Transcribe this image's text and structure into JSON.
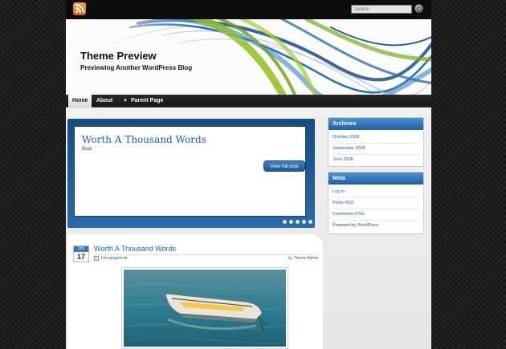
{
  "search": {
    "placeholder": "Search"
  },
  "header": {
    "site_title": "Theme Preview",
    "site_description": "Previewing Another WordPress Blog"
  },
  "nav": {
    "items": [
      {
        "label": "Home",
        "active": true
      },
      {
        "label": "About",
        "active": false
      },
      {
        "label": "Parent Page",
        "active": false,
        "has_dropdown": true
      }
    ]
  },
  "slider": {
    "title": "Worth A Thousand Words",
    "caption": "Boat",
    "button_label": "View full post",
    "dots": 5
  },
  "post": {
    "date_month": "Oct",
    "date_day": "17",
    "title": "Worth A Thousand Words",
    "category": "Uncategorized",
    "by_prefix": "by",
    "author": "Theme Admin",
    "image_icon": "boat-photo"
  },
  "sidebar": {
    "archives": {
      "title": "Archives",
      "items": [
        "October 2008",
        "September 2008",
        "June 2008"
      ]
    },
    "meta": {
      "title": "Meta",
      "items": [
        "Log in",
        "Posts RSS",
        "Comments RSS"
      ],
      "powered_by": "Powered by",
      "powered_link": "WordPress"
    }
  },
  "colors": {
    "accent_blue": "#1d5f9e",
    "widget_header": "#2f74b8",
    "header_swoosh_green": "#8fbf1f",
    "header_swoosh_blue": "#2a6fb6"
  }
}
